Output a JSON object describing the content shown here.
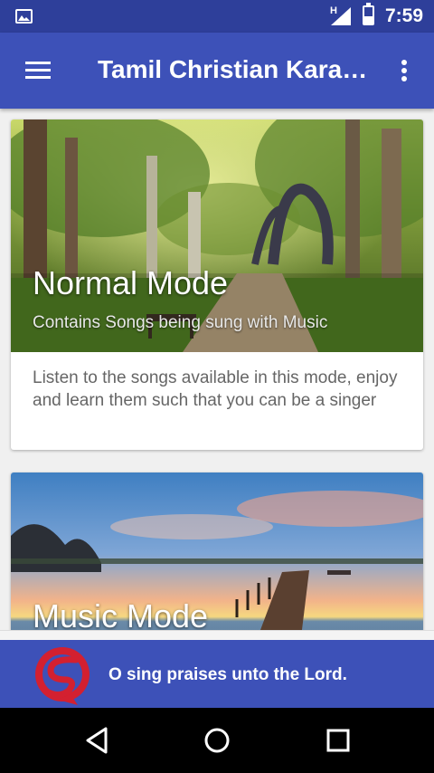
{
  "status_bar": {
    "network_type": "H",
    "time": "7:59",
    "icons": [
      "image-icon",
      "signal-icon",
      "battery-icon"
    ]
  },
  "app_bar": {
    "title": "Tamil Christian Kara…",
    "menu_icon": "hamburger-menu-icon",
    "more_icon": "more-vertical-icon"
  },
  "cards": [
    {
      "title": "Normal Mode",
      "subtitle": "Contains Songs being sung with Music",
      "description": "Listen to the songs available in this mode, enjoy and learn them such that you can be a singer"
    },
    {
      "title": "Music Mode"
    }
  ],
  "banner": {
    "text": "O sing praises unto the Lord.",
    "logo": "app-logo"
  },
  "nav_bar": {
    "buttons": [
      "back-icon",
      "home-icon",
      "recents-icon"
    ]
  },
  "colors": {
    "status_bar": "#2e3f9a",
    "app_bar": "#3d51b8",
    "banner": "#3d51b8",
    "logo_red": "#d32030"
  }
}
